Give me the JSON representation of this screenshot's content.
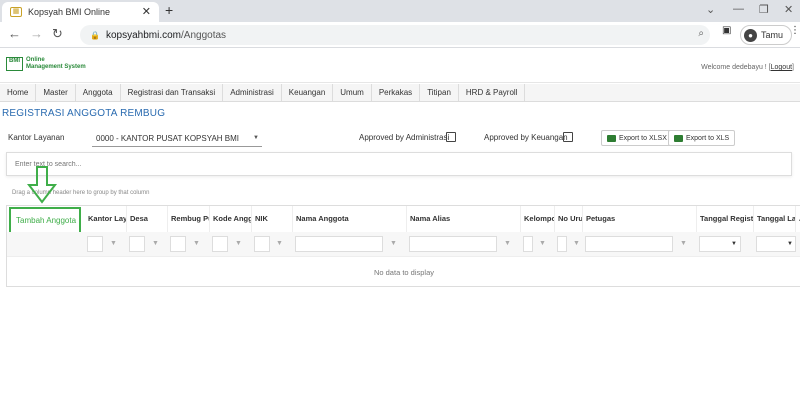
{
  "browser": {
    "tab_title": "Kopsyah BMI Online",
    "url_domain": "kopsyahbmi.com",
    "url_path": "/Anggotas",
    "profile_name": "Tamu"
  },
  "app": {
    "logo_line1": "Online",
    "logo_line2": "Management System",
    "welcome_text": "Welcome dedebayu ! [",
    "logout_label": "Logout",
    "welcome_close": "]"
  },
  "menu": [
    "Home",
    "Master",
    "Anggota",
    "Registrasi dan Transaksi",
    "Administrasi",
    "Keuangan",
    "Umum",
    "Perkakas",
    "Titipan",
    "HRD & Payroll"
  ],
  "page": {
    "title": "REGISTRASI ANGGOTA REMBUG",
    "kantor_label": "Kantor Layanan",
    "kantor_value": "0000 - KANTOR PUSAT KOPSYAH BMI",
    "approved_admin_label": "Approved by Administrasi",
    "approved_keuangan_label": "Approved by Keuangan",
    "export_xlsx": "Export to XLSX",
    "export_xls": "Export to XLS",
    "search_placeholder": "Enter text to search...",
    "group_info": "Drag a column header here to group by that column"
  },
  "grid": {
    "add_button": "Tambah Anggota",
    "columns": [
      "Kantor Lay",
      "Desa",
      "Rembug Pu",
      "Kode Angg",
      "NIK",
      "Nama Anggota",
      "Nama Alias",
      "Kelompo",
      "No Uru",
      "Petugas",
      "Tanggal Registr",
      "Tanggal La",
      "A"
    ],
    "empty_text": "No data to display"
  },
  "colors": {
    "accent_green": "#3fae49",
    "title_blue": "#2a6bb0"
  }
}
